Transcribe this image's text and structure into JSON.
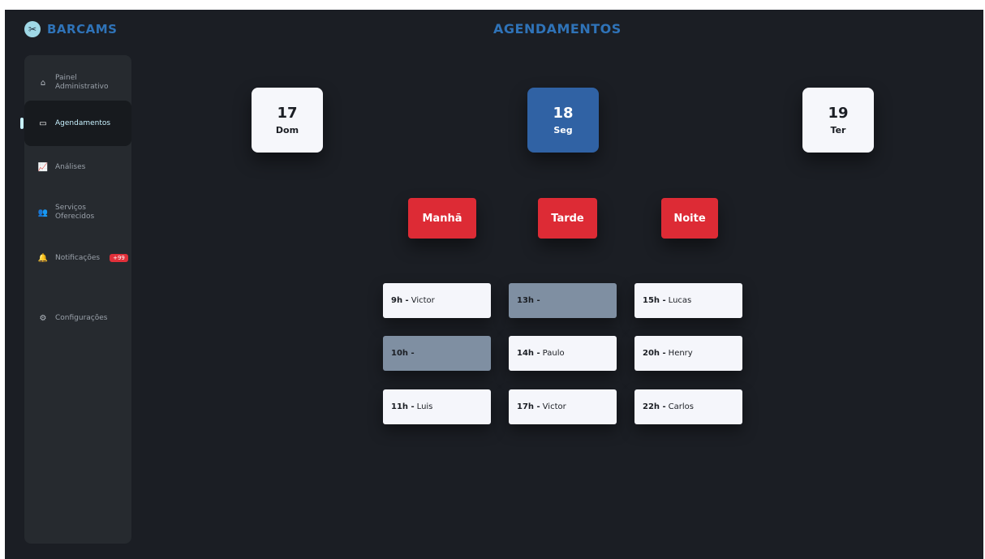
{
  "brand": {
    "name": "BARCAMS",
    "logo_icon": "barber-pole-icon",
    "color": "#2f73b8"
  },
  "page": {
    "title": "AGENDAMENTOS"
  },
  "sidebar": {
    "items": [
      {
        "label": "Painel Administrativo",
        "icon": "admin-panel-icon"
      },
      {
        "label": "Agendamentos",
        "icon": "calendar-icon",
        "active": true
      },
      {
        "label": "Análises",
        "icon": "chart-icon"
      },
      {
        "label": "Serviços Oferecidos",
        "icon": "users-icon"
      },
      {
        "label": "Notificações",
        "icon": "bell-icon",
        "badge": "+99"
      },
      {
        "label": "Configurações",
        "icon": "gear-icon"
      }
    ]
  },
  "days": [
    {
      "num": "17",
      "dow": "Dom"
    },
    {
      "num": "18",
      "dow": "Seg",
      "selected": true
    },
    {
      "num": "19",
      "dow": "Ter"
    }
  ],
  "periods": [
    "Manhã",
    "Tarde",
    "Noite"
  ],
  "slots": {
    "morning": [
      {
        "hour": "9h -",
        "name": "Victor"
      },
      {
        "hour": "10h -",
        "name": "",
        "empty": true
      },
      {
        "hour": "11h -",
        "name": "Luis"
      }
    ],
    "afternoon": [
      {
        "hour": "13h -",
        "name": "",
        "empty": true
      },
      {
        "hour": "14h -",
        "name": "Paulo"
      },
      {
        "hour": "17h -",
        "name": "Victor"
      }
    ],
    "night": [
      {
        "hour": "15h -",
        "name": "Lucas"
      },
      {
        "hour": "20h -",
        "name": "Henry"
      },
      {
        "hour": "22h -",
        "name": "Carlos"
      }
    ]
  },
  "colors": {
    "accent": "#dd2b35",
    "selected": "#3062a4",
    "background": "#1b1e24"
  }
}
